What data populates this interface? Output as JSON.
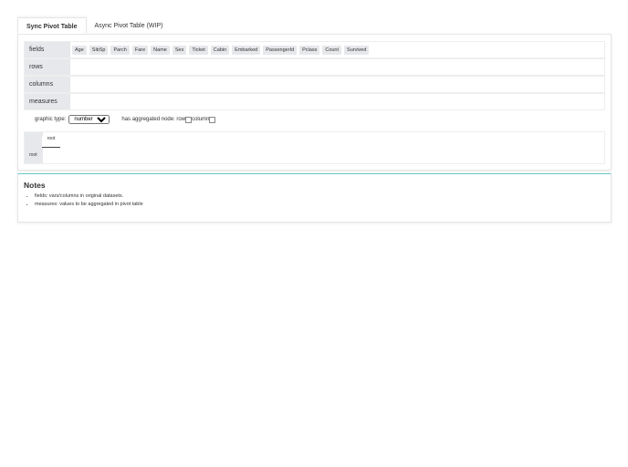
{
  "tabs": [
    {
      "label": "Sync Pivot Table",
      "active": true
    },
    {
      "label": "Async Pivot Table (WIP)",
      "active": false
    }
  ],
  "sections": {
    "fields": "fields",
    "rows": "rows",
    "columns": "columns",
    "measures": "measures"
  },
  "fields": [
    "Age",
    "SibSp",
    "Parch",
    "Fare",
    "Name",
    "Sex",
    "Ticket",
    "Cabin",
    "Embarked",
    "PassengerId",
    "Pclass",
    "Count",
    "Survived"
  ],
  "options": {
    "graphic_type_label": "graphic type:",
    "graphic_type_value": "number",
    "aggregated_label": "has aggregated node: row",
    "column_label": "column"
  },
  "pivot": {
    "column_header": "root",
    "row_header": "root"
  },
  "notes": {
    "title": "Notes",
    "items": [
      "fields: vars/columns in original datasets.",
      "measures: values to be aggregated in pivot table"
    ]
  }
}
